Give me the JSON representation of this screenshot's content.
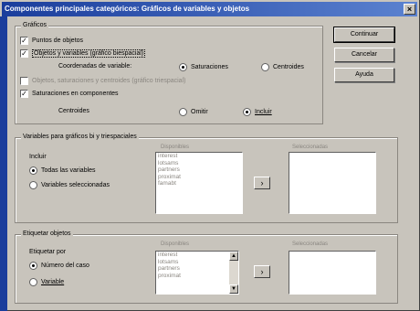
{
  "window": {
    "title": "Componentes principales categóricos: Gráficos de variables y objetos",
    "close_glyph": "×"
  },
  "graficos": {
    "title": "Gráficos",
    "puntos_objetos": {
      "label": "Puntos de objetos",
      "checked": true,
      "check_glyph": "✓"
    },
    "objetos_variables": {
      "label": "Objetos y variables (gráfico biespacial)",
      "checked": true,
      "check_glyph": "✓"
    },
    "coordenadas_label": "Coordenadas de variable:",
    "coord_saturaciones": {
      "label": "Saturaciones",
      "selected": true
    },
    "coord_centroides": {
      "label": "Centroides",
      "selected": false
    },
    "disabled_option": {
      "label": "Objetos, saturaciones y centroides (gráfico triespacial)",
      "checked": false
    },
    "saturaciones_componentes": {
      "label": "Saturaciones en componentes",
      "checked": true,
      "check_glyph": "✓"
    },
    "centroides_label": "Centroides",
    "centroides_omitir": {
      "label": "Omitir",
      "selected": false
    },
    "centroides_incluir": {
      "label": "Incluir",
      "selected": true
    }
  },
  "buttons": {
    "continuar": "Continuar",
    "cancelar": "Cancelar",
    "ayuda": "Ayuda"
  },
  "variables_group": {
    "title": "Variables para gráficos bi y triespaciales",
    "incluir_label": "Incluir",
    "todas": {
      "label": "Todas las variables",
      "selected": true
    },
    "seleccionadas": {
      "label": "Variables seleccionadas",
      "selected": false
    },
    "source_label": "Disponibles",
    "target_label": "Seleccionadas",
    "source_items": [
      "interest",
      "lotsams",
      "partners",
      "proximat",
      "famabt"
    ],
    "arrow_glyph": "›"
  },
  "etiquetar_group": {
    "title": "Etiquetar objetos",
    "etiquetar_por_label": "Etiquetar por",
    "numero_caso": {
      "label": "Número del caso",
      "selected": true
    },
    "variable": {
      "label": "Variable",
      "selected": false
    },
    "source_label": "Disponibles",
    "target_label": "Seleccionadas",
    "source_items": [
      "interest",
      "lotsams",
      "partners",
      "proximat"
    ],
    "arrow_glyph": "›",
    "scroll_up_glyph": "▲",
    "scroll_down_glyph": "▼"
  }
}
